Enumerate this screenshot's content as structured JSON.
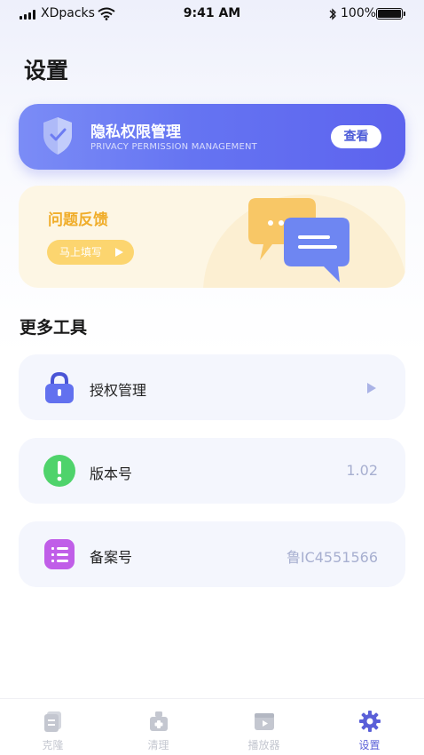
{
  "status_bar": {
    "carrier": "XDpacks",
    "time": "9:41 AM",
    "battery_percent": "100%",
    "battery_level": 1.0
  },
  "page": {
    "title": "设置"
  },
  "privacy_card": {
    "title": "隐私权限管理",
    "subtitle": "PRIVACY PERMISSION MANAGEMENT",
    "button_label": "查看",
    "icon": "shield-check-icon"
  },
  "feedback_card": {
    "title": "问题反馈",
    "button_label": "马上填写",
    "icon": "chat-bubbles-icon"
  },
  "tools": {
    "section_title": "更多工具",
    "items": [
      {
        "label": "授权管理",
        "value": "",
        "icon": "lock-icon",
        "has_arrow": true
      },
      {
        "label": "版本号",
        "value": "1.02",
        "icon": "exclamation-icon",
        "has_arrow": false
      },
      {
        "label": "备案号",
        "value": "鲁IC4551566",
        "icon": "list-icon",
        "has_arrow": false
      }
    ]
  },
  "tab_bar": {
    "items": [
      {
        "label": "克隆",
        "icon": "clone-icon",
        "active": false
      },
      {
        "label": "清理",
        "icon": "clean-icon",
        "active": false
      },
      {
        "label": "播放器",
        "icon": "player-icon",
        "active": false
      },
      {
        "label": "设置",
        "icon": "gear-icon",
        "active": true
      }
    ]
  },
  "colors": {
    "accent": "#5a5fd8",
    "privacy_gradient_start": "#7b8cf6",
    "privacy_gradient_end": "#5d63ee",
    "feedback_title": "#f0ad2a",
    "feedback_button": "#fcd56f",
    "tool_row_bg": "#f4f6fd",
    "muted_value": "#a7afd0"
  }
}
